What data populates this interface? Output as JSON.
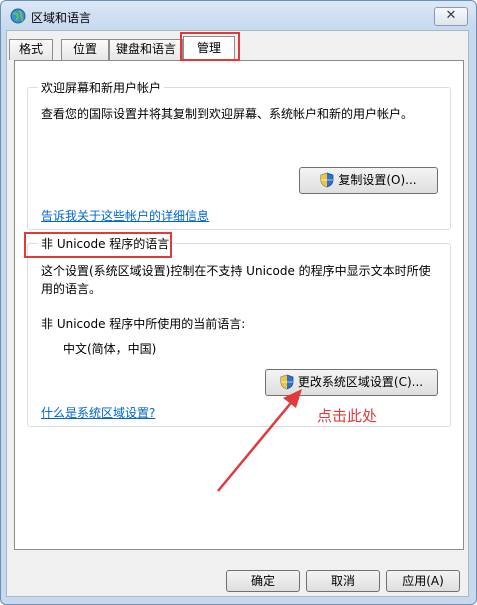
{
  "window": {
    "title": "区域和语言",
    "close_glyph": "✕"
  },
  "tabs": [
    {
      "label": "格式",
      "active": false
    },
    {
      "label": "位置",
      "active": false
    },
    {
      "label": "键盘和语言",
      "active": false
    },
    {
      "label": "管理",
      "active": true
    }
  ],
  "welcome_group": {
    "title": "欢迎屏幕和新用户帐户",
    "description": "查看您的国际设置并将其复制到欢迎屏幕、系统帐户和新的用户帐户。",
    "copy_button": "复制设置(O)...",
    "link": "告诉我关于这些帐户的详细信息"
  },
  "unicode_group": {
    "title": "非 Unicode 程序的语言",
    "description_line1": "这个设置(系统区域设置)控制在不支持 Unicode 的程序中显示文本时所使",
    "description_line2": "用的语言。",
    "current_label": "非 Unicode 程序中所使用的当前语言:",
    "current_value": "中文(简体，中国)",
    "change_button": "更改系统区域设置(C)...",
    "link": "什么是系统区域设置?"
  },
  "annotation": {
    "text": "点击此处",
    "color": "#e23a3a"
  },
  "footer": {
    "ok": "确定",
    "cancel": "取消",
    "apply": "应用(A)"
  }
}
